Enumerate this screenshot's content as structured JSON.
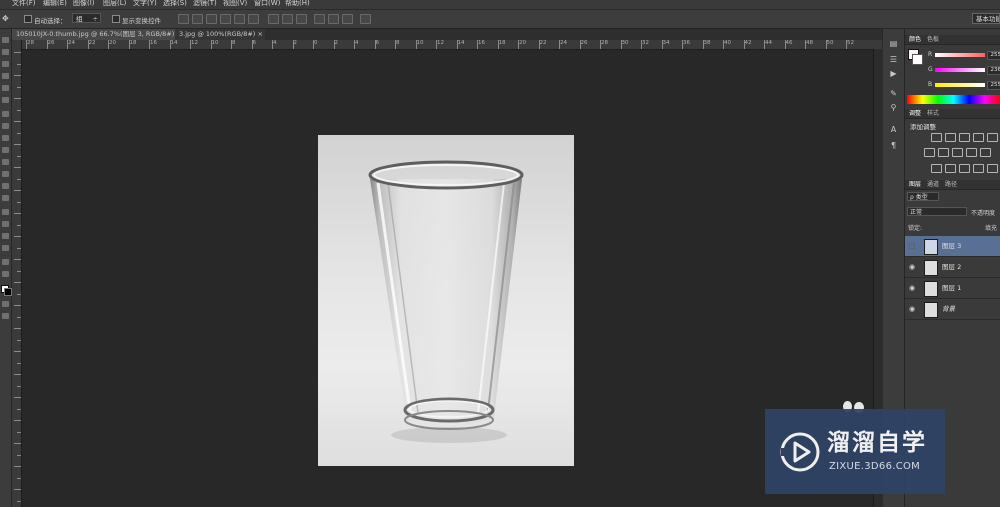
{
  "menu": [
    "文件(F)",
    "编辑(E)",
    "图像(I)",
    "图层(L)",
    "文字(Y)",
    "选择(S)",
    "滤镜(T)",
    "视图(V)",
    "窗口(W)",
    "帮助(H)"
  ],
  "options": {
    "auto_select_label": "自动选择：",
    "auto_select_value": "组",
    "show_transform_label": "显示变换控件",
    "workspace_label": "基本功能"
  },
  "tabs": [
    {
      "label": "105010JX-0.thumb.jpg @ 66.7%(图层 3, RGB/8#) *",
      "active": true
    },
    {
      "label": "3.jpg @ 100%(RGB/8#)",
      "active": false
    }
  ],
  "ruler_labels": [
    "28",
    "26",
    "24",
    "22",
    "20",
    "18",
    "16",
    "14",
    "12",
    "10",
    "8",
    "6",
    "4",
    "2",
    "0",
    "2",
    "4",
    "6",
    "8",
    "10",
    "12",
    "14",
    "16",
    "18",
    "20",
    "22",
    "24",
    "26",
    "28",
    "30",
    "32",
    "34",
    "36",
    "38",
    "40",
    "42",
    "44",
    "46",
    "48",
    "50",
    "52"
  ],
  "color_panel": {
    "tabs": [
      "颜色",
      "色板"
    ],
    "channels": [
      {
        "label": "R",
        "value": "255",
        "color": "#ff5f5f"
      },
      {
        "label": "G",
        "value": "236",
        "color": "#e36ee0"
      },
      {
        "label": "B",
        "value": "255",
        "color": "#e6e070"
      }
    ]
  },
  "adjust_panel": {
    "tabs": [
      "调整",
      "样式"
    ],
    "title": "添加调整"
  },
  "layers_panel": {
    "tabs": [
      "图层",
      "通道",
      "路径"
    ],
    "filter_value": "ρ 类型",
    "blend_mode": "正常",
    "opacity_label": "不透明度",
    "lock_label": "锁定:",
    "fill_label": "填充",
    "layers": [
      {
        "name": "图层 3",
        "selected": true,
        "visible": false
      },
      {
        "name": "图层 2",
        "selected": false,
        "visible": true
      },
      {
        "name": "图层 1",
        "selected": false,
        "visible": true
      },
      {
        "name": "背景",
        "selected": false,
        "visible": true
      }
    ]
  },
  "watermark": {
    "brand": "溜溜自学",
    "site": "ZIXUE.3D66.COM"
  },
  "accent_color": "#2f4366"
}
